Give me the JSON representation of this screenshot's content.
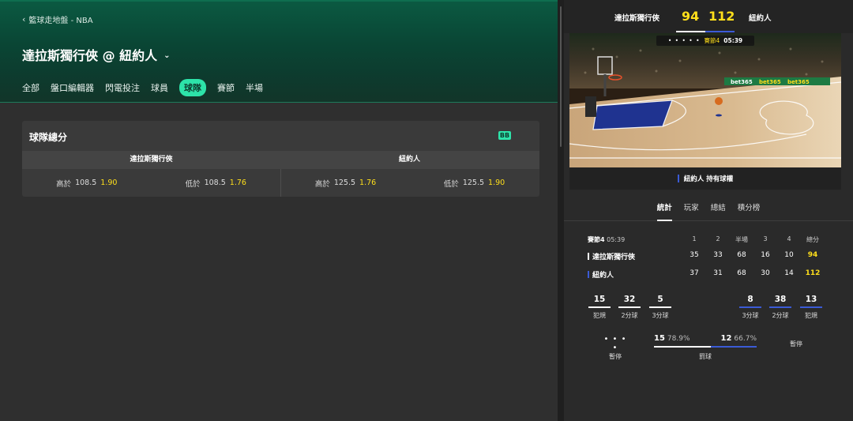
{
  "breadcrumb": "籃球走地盤 - NBA",
  "match_title": "達拉斯獨行俠 @ 紐約人",
  "tabs": [
    "全部",
    "盤口編輯器",
    "閃電投注",
    "球員",
    "球隊",
    "賽節",
    "半場"
  ],
  "active_tab": "球隊",
  "market": {
    "title": "球隊總分",
    "badge": "BB",
    "teams": [
      "達拉斯獨行俠",
      "紐約人"
    ],
    "odds": [
      {
        "label": "高於",
        "line": "108.5",
        "price": "1.90"
      },
      {
        "label": "低於",
        "line": "108.5",
        "price": "1.76"
      },
      {
        "label": "高於",
        "line": "125.5",
        "price": "1.76"
      },
      {
        "label": "低於",
        "line": "125.5",
        "price": "1.90"
      }
    ]
  },
  "scoreboard": {
    "home": "達拉斯獨行俠",
    "away": "紐約人",
    "home_score": "94",
    "away_score": "112",
    "quarter": "賽節4",
    "clock": "05:39",
    "dots": "• • • • •",
    "possession": "紐約人 持有球權",
    "ads": [
      "bet365",
      "bet365",
      "bet365"
    ]
  },
  "right_tabs": [
    "統計",
    "玩家",
    "總結",
    "積分榜"
  ],
  "right_active_tab": "統計",
  "box": {
    "period_label": "賽節4",
    "period_clock": "05:39",
    "columns": [
      "1",
      "2",
      "半場",
      "3",
      "4",
      "總分"
    ],
    "rows": [
      {
        "team": "達拉斯獨行俠",
        "values": [
          "35",
          "33",
          "68",
          "16",
          "10",
          "94"
        ]
      },
      {
        "team": "紐約人",
        "values": [
          "37",
          "31",
          "68",
          "30",
          "14",
          "112"
        ]
      }
    ]
  },
  "team_stats": {
    "home": [
      {
        "value": "15",
        "label": "犯規"
      },
      {
        "value": "32",
        "label": "2分球"
      },
      {
        "value": "5",
        "label": "3分球"
      }
    ],
    "away": [
      {
        "value": "8",
        "label": "3分球"
      },
      {
        "value": "38",
        "label": "2分球"
      },
      {
        "value": "13",
        "label": "犯規"
      }
    ],
    "home_timeouts_label": "暫停",
    "home_timeouts_dots": "• • • •",
    "away_timeouts_label": "暫停",
    "free_throws": {
      "label": "罰球",
      "home_made": "15",
      "home_pct": "78.9%",
      "away_made": "12",
      "away_pct": "66.7%"
    }
  },
  "colors": {
    "accent": "#2de3a9",
    "price": "#ffdf1b",
    "home": "#ffffff",
    "away": "#3b5bd6"
  }
}
